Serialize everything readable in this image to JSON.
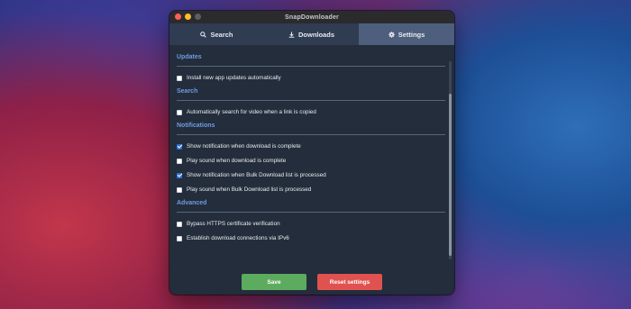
{
  "window": {
    "title": "SnapDownloader"
  },
  "tabs": [
    {
      "label": "Search",
      "icon": "search-icon"
    },
    {
      "label": "Downloads",
      "icon": "download-icon"
    },
    {
      "label": "Settings",
      "icon": "gear-icon"
    }
  ],
  "active_tab": "Settings",
  "sections": {
    "updates": {
      "title": "Updates",
      "options": [
        {
          "label": "Install new app updates automatically",
          "checked": false
        }
      ]
    },
    "search": {
      "title": "Search",
      "options": [
        {
          "label": "Automatically search for video when a link is copied",
          "checked": false
        }
      ]
    },
    "notifications": {
      "title": "Notifications",
      "options": [
        {
          "label": "Show notification when download is complete",
          "checked": true
        },
        {
          "label": "Play sound when download is complete",
          "checked": false
        },
        {
          "label": "Show notification when Bulk Download list is processed",
          "checked": true
        },
        {
          "label": "Play sound when Bulk Download list is processed",
          "checked": false
        }
      ]
    },
    "advanced": {
      "title": "Advanced",
      "options": [
        {
          "label": "Bypass HTTPS certificate verification",
          "checked": false
        },
        {
          "label": "Establish download connections via IPv6",
          "checked": false
        }
      ]
    }
  },
  "footer": {
    "save_label": "Save",
    "reset_label": "Reset settings"
  },
  "colors": {
    "accent": "#6f9ce0",
    "save": "#5dab5f",
    "reset": "#e0524f",
    "active_tab": "#4d5f7c"
  }
}
